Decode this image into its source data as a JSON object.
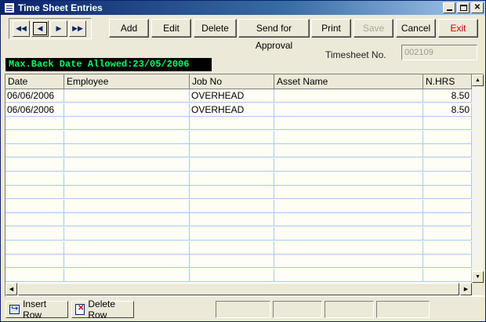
{
  "window": {
    "title": "Time Sheet Entries"
  },
  "nav": {
    "first": "◀◀",
    "prev": "◀",
    "next": "▶",
    "last": "▶▶"
  },
  "toolbar": {
    "add": "Add",
    "edit": "Edit",
    "delete": "Delete",
    "send": "Send for Approval",
    "print": "Print",
    "save": "Save",
    "cancel": "Cancel",
    "exit": "Exit"
  },
  "info": {
    "max_back_date": "Max.Back Date Allowed:23/05/2006",
    "timesheet_label": "Timesheet No.",
    "timesheet_value": "002109"
  },
  "grid": {
    "columns": [
      "Date",
      "Employee",
      "Job No",
      "Asset Name",
      "N.HRS"
    ],
    "rows": [
      {
        "date": "06/06/2006",
        "employee": "",
        "job": "OVERHEAD",
        "asset": "",
        "hrs": "8.50"
      },
      {
        "date": "06/06/2006",
        "employee": "",
        "job": "OVERHEAD",
        "asset": "",
        "hrs": "8.50"
      }
    ]
  },
  "footer": {
    "insert_row": "Insert Row",
    "delete_row": "Delete Row"
  },
  "colors": {
    "title_bar": "#0a246a",
    "max_date_text": "#00ff66",
    "grid_line": "#a6caf0"
  }
}
